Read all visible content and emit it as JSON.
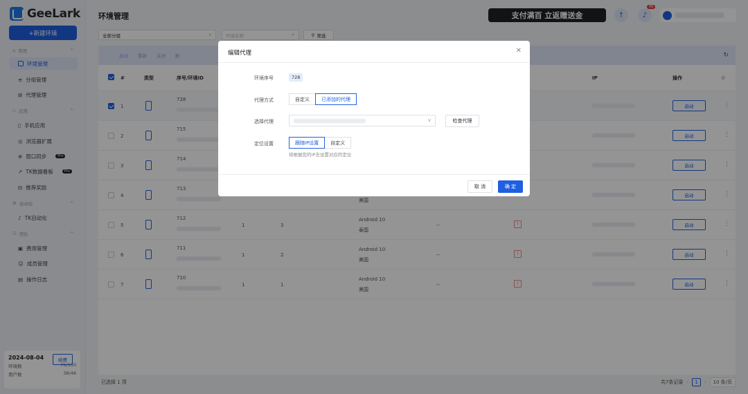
{
  "sidebar": {
    "logo_text": "GeeLark",
    "new_env_label": "+新建环境",
    "groups": [
      {
        "label": "常用"
      },
      {
        "label": "应用"
      },
      {
        "label": "自动化"
      },
      {
        "label": "团队"
      }
    ],
    "items": [
      {
        "label": "环境管理"
      },
      {
        "label": "分组管理"
      },
      {
        "label": "代理管理"
      },
      {
        "label": "手机应用"
      },
      {
        "label": "浏览器扩展"
      },
      {
        "label": "窗口同步",
        "badge": "Pro"
      },
      {
        "label": "TK数据看板",
        "badge": "Pro"
      },
      {
        "label": "推荐奖励"
      },
      {
        "label": "TK自动化"
      },
      {
        "label": "费用管理"
      },
      {
        "label": "成员管理"
      },
      {
        "label": "操作日志"
      }
    ],
    "footer": {
      "date": "2024-08-04",
      "renew_label": "续费",
      "env_count_label": "环境数",
      "env_count_value": "76/150",
      "user_count_label": "用户数",
      "user_count_value": "38/48"
    }
  },
  "header": {
    "title": "环境管理",
    "promo_text": "支付满百 立返赠送金",
    "notification_count": "99"
  },
  "filters": {
    "group_select": "全部分组",
    "search_placeholder": "环境名称",
    "filter_label": "筛选"
  },
  "toolbar": {
    "actions": [
      "启动",
      "重新",
      "关闭",
      "删"
    ]
  },
  "table": {
    "headers": {
      "index": "#",
      "type": "类型",
      "name": "序号/环境ID",
      "ip": "IP",
      "action": "操作"
    },
    "rows": [
      {
        "index": "1",
        "serial": "728",
        "col_a": "",
        "col_b": "",
        "os": "",
        "region": "",
        "launch": "启动",
        "checked": true
      },
      {
        "index": "2",
        "serial": "715",
        "col_a": "",
        "col_b": "",
        "os": "",
        "region": "",
        "launch": "启动",
        "checked": false
      },
      {
        "index": "3",
        "serial": "714",
        "col_a": "",
        "col_b": "",
        "os": "",
        "region": "",
        "launch": "启动",
        "checked": false
      },
      {
        "index": "4",
        "serial": "713",
        "col_a": "",
        "col_b": "",
        "os": "",
        "region": "美国",
        "launch": "启动",
        "checked": false
      },
      {
        "index": "5",
        "serial": "712",
        "col_a": "1",
        "col_b": "3",
        "os": "Android 10",
        "region": "泰国",
        "launch": "启动",
        "checked": false
      },
      {
        "index": "6",
        "serial": "711",
        "col_a": "1",
        "col_b": "2",
        "os": "Android 10",
        "region": "美国",
        "launch": "启动",
        "checked": false
      },
      {
        "index": "7",
        "serial": "710",
        "col_a": "1",
        "col_b": "1",
        "os": "Android 10",
        "region": "美国",
        "launch": "启动",
        "checked": false
      }
    ],
    "dash": "--"
  },
  "footer": {
    "selected_text": "已选择 1 项",
    "total_text": "共7条记录",
    "page": "1",
    "per_page": "10 条/页"
  },
  "modal": {
    "title": "编辑代理",
    "env_serial_label": "环境序号",
    "env_serial_value": "728",
    "proxy_mode_label": "代理方式",
    "proxy_mode_options": [
      "自定义",
      "已添加的代理"
    ],
    "select_proxy_label": "选择代理",
    "check_proxy_label": "检查代理",
    "location_label": "定位设置",
    "location_options": [
      "跟随IP设置",
      "自定义"
    ],
    "location_hint": "将根据您的IP去设置对应的定位",
    "cancel_label": "取 消",
    "confirm_label": "确 定"
  },
  "colors": {
    "accent": "#1f5fe0",
    "promo_bg": "#222222",
    "overlay": "rgba(0,0,0,0.42)"
  }
}
